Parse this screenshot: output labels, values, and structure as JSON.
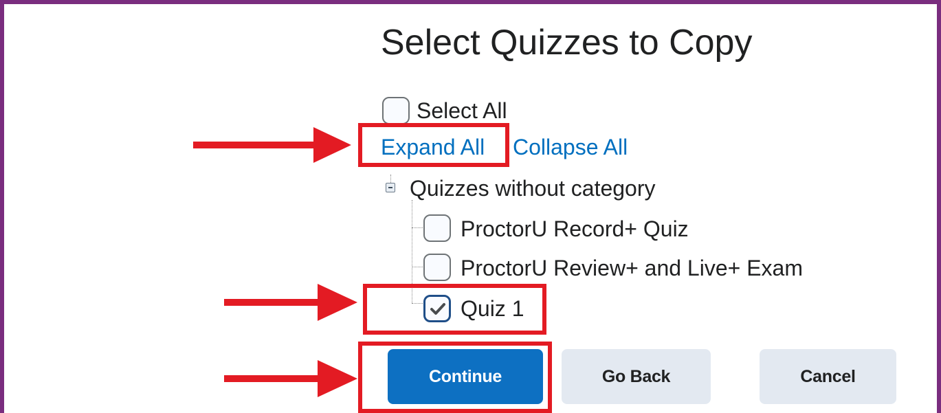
{
  "dialog": {
    "title": "Select Quizzes to Copy",
    "select_all_label": "Select All",
    "select_all_checked": false,
    "expand_all_label": "Expand All",
    "collapse_all_label": "Collapse All"
  },
  "tree": {
    "category_label": "Quizzes without category",
    "items": [
      {
        "label": "ProctorU Record+ Quiz",
        "checked": false
      },
      {
        "label": "ProctorU Review+ and Live+ Exam",
        "checked": false
      },
      {
        "label": "Quiz 1",
        "checked": true
      }
    ]
  },
  "buttons": {
    "continue_label": "Continue",
    "go_back_label": "Go Back",
    "cancel_label": "Cancel"
  },
  "colors": {
    "frame": "#7a2d7f",
    "link": "#006fbf",
    "primary_button": "#0d70c2",
    "secondary_button": "#e3e9f1",
    "annotation": "#e31b23"
  }
}
